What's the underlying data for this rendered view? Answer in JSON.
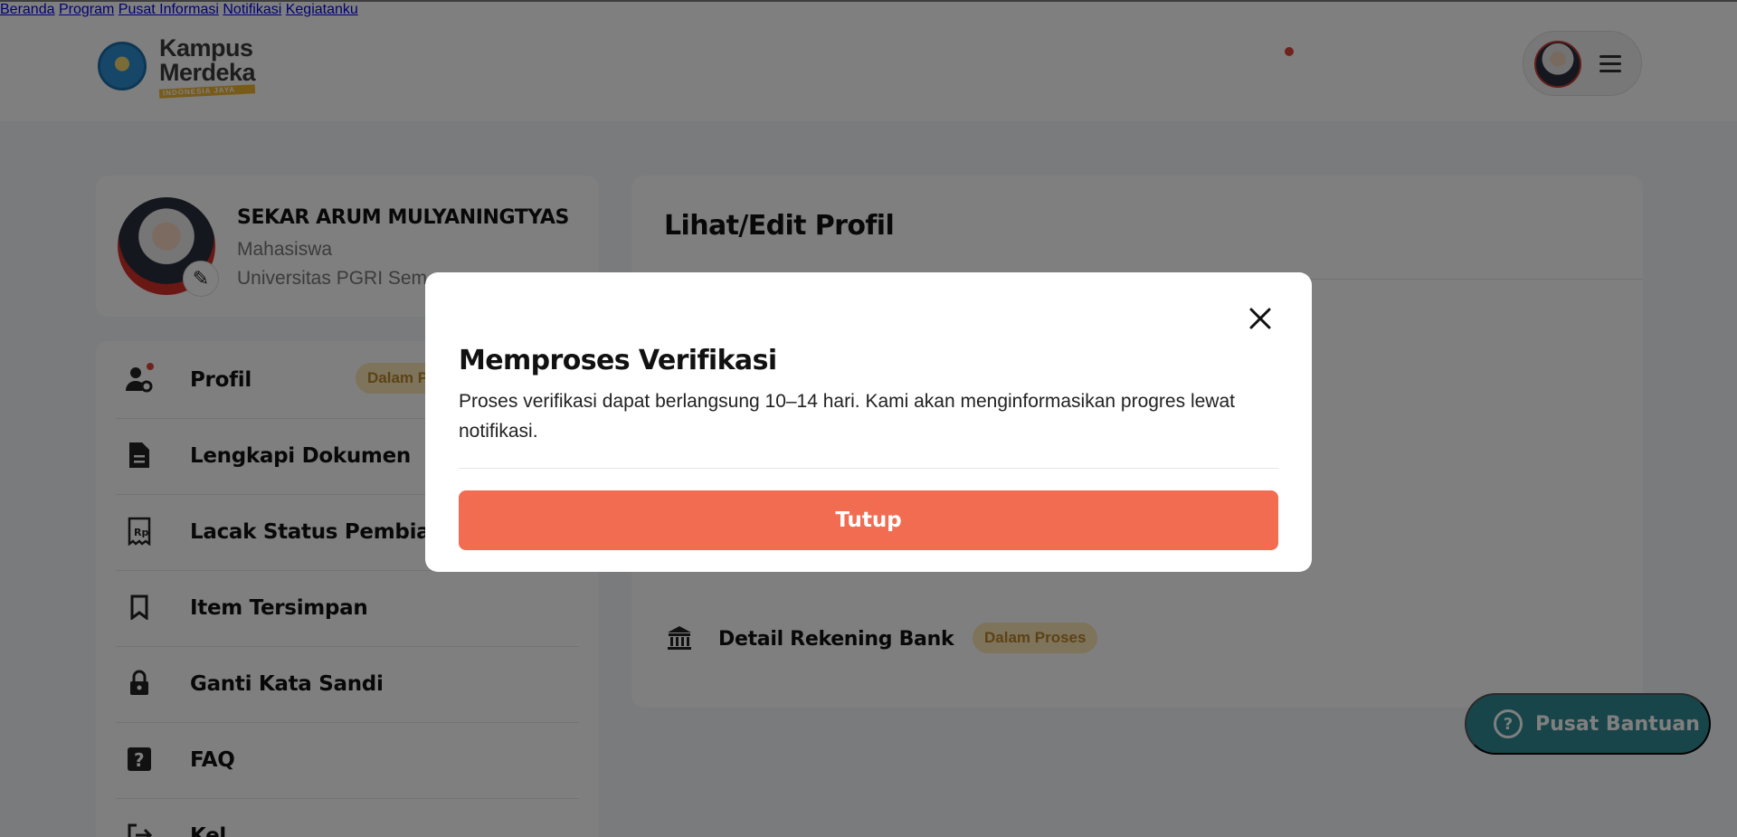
{
  "brand": {
    "line1": "Kampus",
    "line2": "Merdeka",
    "tagline": "INDONESIA JAYA"
  },
  "nav": {
    "items": [
      "Beranda",
      "Program",
      "Pusat Informasi",
      "Notifikasi",
      "Kegiatanku"
    ]
  },
  "profile": {
    "name": "SEKAR ARUM MULYANINGTYAS",
    "role": "Mahasiswa",
    "university": "Universitas PGRI Sem"
  },
  "menu": {
    "items": [
      {
        "label": "Profil",
        "icon": "user-gear-icon",
        "badge": "Dalam Proses"
      },
      {
        "label": "Lengkapi Dokumen",
        "icon": "document-icon"
      },
      {
        "label": "Lacak Status Pembiayaa",
        "icon": "receipt-icon"
      },
      {
        "label": "Item Tersimpan",
        "icon": "bookmark-icon"
      },
      {
        "label": "Ganti Kata Sandi",
        "icon": "lock-icon"
      },
      {
        "label": "FAQ",
        "icon": "question-icon"
      },
      {
        "label": "Kel",
        "icon": "logout-icon"
      }
    ]
  },
  "main": {
    "title": "Lihat/Edit Profil",
    "bank_label": "Detail Rekening Bank",
    "bank_badge": "Dalam Proses"
  },
  "help": {
    "label": "Pusat Bantuan"
  },
  "modal": {
    "title": "Memproses Verifikasi",
    "body": "Proses verifikasi dapat berlangsung 10–14 hari. Kami akan menginformasikan progres lewat notifikasi.",
    "button": "Tutup"
  },
  "colors": {
    "accent": "#f26c52",
    "help": "#2e8b94",
    "badge_bg": "#fde7b6",
    "badge_text": "#b8862c",
    "notif_dot": "#e0453a"
  }
}
